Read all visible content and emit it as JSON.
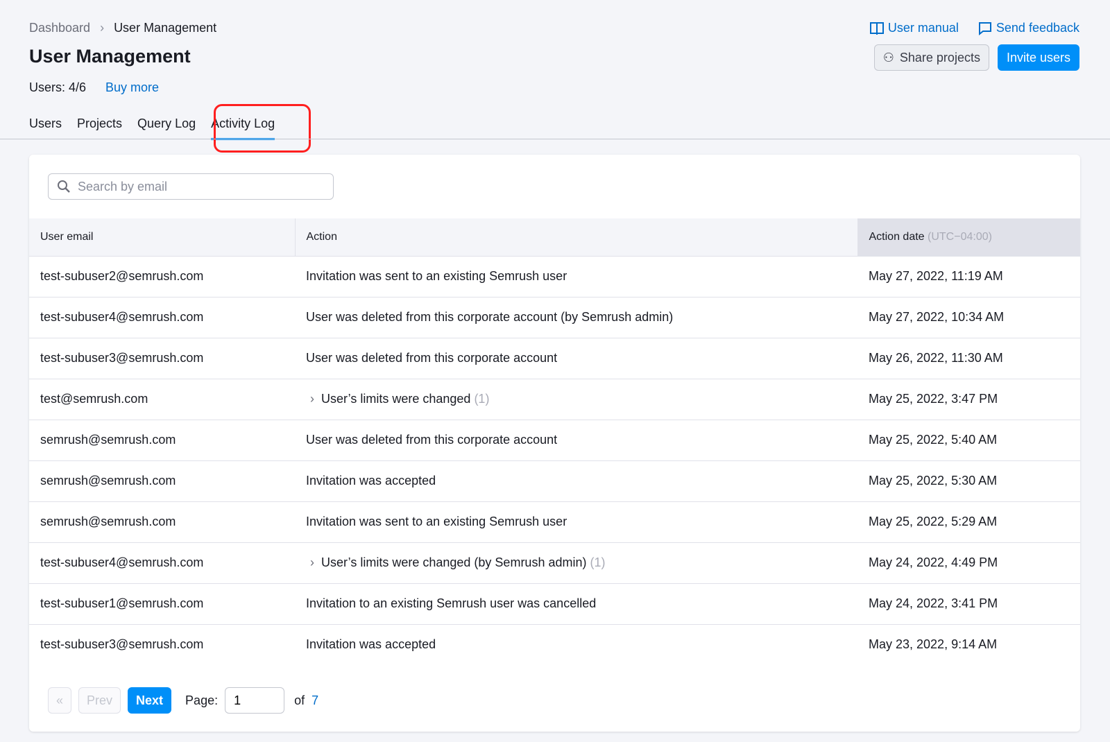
{
  "breadcrumb": [
    "Dashboard",
    "User Management"
  ],
  "title": "User Management",
  "users_count": "Users: 4/6",
  "buy_more": "Buy more",
  "links": {
    "manual": "User manual",
    "feedback": "Send feedback"
  },
  "buttons": {
    "share": "Share projects",
    "invite": "Invite users"
  },
  "tabs": [
    "Users",
    "Projects",
    "Query Log",
    "Activity Log"
  ],
  "search_placeholder": "Search by email",
  "columns": {
    "email": "User email",
    "action": "Action",
    "date": "Action date",
    "tz": "(UTC−04:00)"
  },
  "rows": [
    {
      "email": "test-subuser2@semrush.com",
      "action": "Invitation was sent to an existing Semrush user",
      "count": "",
      "date": "May 27, 2022, 11:19 AM"
    },
    {
      "email": "test-subuser4@semrush.com",
      "action": "User was deleted from this corporate account (by Semrush admin)",
      "count": "",
      "date": "May 27, 2022, 10:34 AM"
    },
    {
      "email": "test-subuser3@semrush.com",
      "action": "User was deleted from this corporate account",
      "count": "",
      "date": "May 26, 2022, 11:30 AM"
    },
    {
      "email": "test@semrush.com",
      "action": "User’s limits were changed",
      "count": "(1)",
      "date": "May 25, 2022, 3:47 PM"
    },
    {
      "email": "semrush@semrush.com",
      "action": "User was deleted from this corporate account",
      "count": "",
      "date": "May 25, 2022, 5:40 AM"
    },
    {
      "email": "semrush@semrush.com",
      "action": "Invitation was accepted",
      "count": "",
      "date": "May 25, 2022, 5:30 AM"
    },
    {
      "email": "semrush@semrush.com",
      "action": "Invitation was sent to an existing Semrush user",
      "count": "",
      "date": "May 25, 2022, 5:29 AM"
    },
    {
      "email": "test-subuser4@semrush.com",
      "action": "User’s limits were changed (by Semrush admin)",
      "count": "(1)",
      "date": "May 24, 2022, 4:49 PM"
    },
    {
      "email": "test-subuser1@semrush.com",
      "action": "Invitation to an existing Semrush user was cancelled",
      "count": "",
      "date": "May 24, 2022, 3:41 PM"
    },
    {
      "email": "test-subuser3@semrush.com",
      "action": "Invitation was accepted",
      "count": "",
      "date": "May 23, 2022, 9:14 AM"
    }
  ],
  "pager": {
    "first": "«",
    "prev": "Prev",
    "next": "Next",
    "page_label": "Page:",
    "page": "1",
    "of": "of",
    "total": "7"
  }
}
